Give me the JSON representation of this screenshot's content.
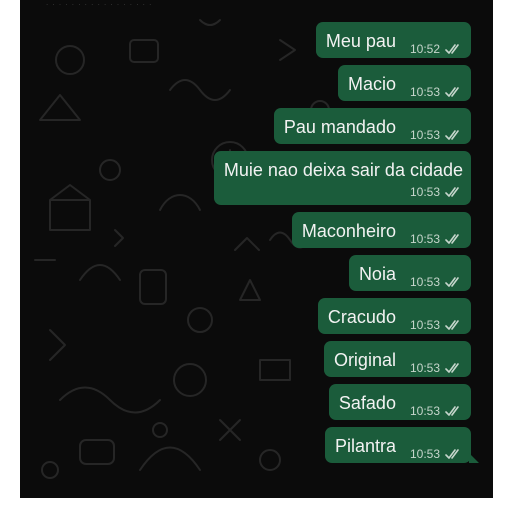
{
  "conversation": {
    "messages": [
      {
        "text": "Meu pau",
        "time": "10:52",
        "status": "read"
      },
      {
        "text": "Macio",
        "time": "10:53",
        "status": "read"
      },
      {
        "text": "Pau mandado",
        "time": "10:53",
        "status": "read"
      },
      {
        "text": "Muie nao deixa sair da cidade",
        "time": "10:53",
        "status": "read"
      },
      {
        "text": "Maconheiro",
        "time": "10:53",
        "status": "read"
      },
      {
        "text": "Noia",
        "time": "10:53",
        "status": "read"
      },
      {
        "text": "Cracudo",
        "time": "10:53",
        "status": "read"
      },
      {
        "text": "Original",
        "time": "10:53",
        "status": "read"
      },
      {
        "text": "Safado",
        "time": "10:53",
        "status": "read"
      },
      {
        "text": "Pilantra",
        "time": "10:53",
        "status": "read"
      }
    ]
  },
  "colors": {
    "background": "#0b0b0b",
    "outgoing_bubble": "#1b5c3b",
    "message_text": "#f2f2f2",
    "meta_text": "#c6d6cc",
    "wallpaper_doodles": "#262626"
  },
  "icons": {
    "read_receipt": "double-check-icon"
  }
}
